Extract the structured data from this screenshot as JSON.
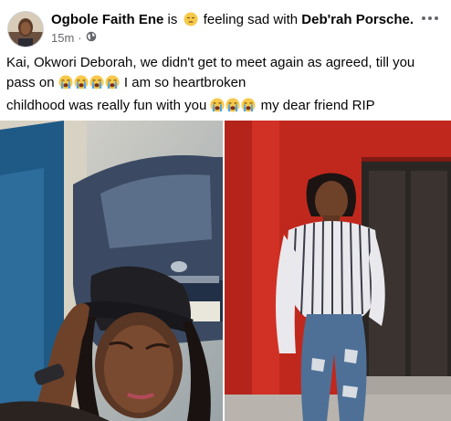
{
  "post": {
    "author": "Ogbole Faith Ene",
    "connector": "is",
    "feeling": "feeling sad with",
    "tagged": "Deb'rah Porsche.",
    "time": "15m",
    "dot": "·",
    "line1": "Kai, Okwori Deborah, we didn't get to meet again as agreed, till you",
    "line2_start": "pass on",
    "line2_end": "I am so heartbroken",
    "line3": "childhood was really fun with you",
    "line4_end": "my dear friend RIP"
  },
  "icons": {
    "sad_face": "pensive-face-icon",
    "crying": "loudly-crying-face-icon",
    "privacy": "globe-icon",
    "more": "more-options-icon"
  },
  "colors": {
    "text": "#050505",
    "meta": "#65676b",
    "emoji": "#f7c94b",
    "tear": "#4aa3f0"
  }
}
